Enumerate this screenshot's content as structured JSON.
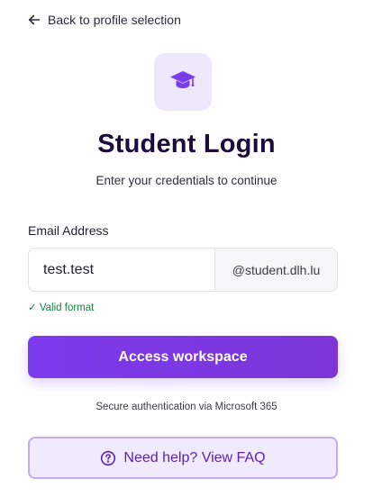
{
  "nav": {
    "back_label": "Back to profile selection",
    "back_icon": "arrow-left-icon"
  },
  "header": {
    "logo_icon": "graduation-cap-icon",
    "title": "Student Login",
    "subtitle": "Enter your credentials to continue"
  },
  "form": {
    "email_label": "Email Address",
    "email_value": "test.test",
    "email_suffix": "@student.dlh.lu",
    "validation_message": "✓ Valid format"
  },
  "actions": {
    "submit_label": "Access workspace",
    "secure_note": "Secure authentication via Microsoft 365",
    "help_label": "Need help? View FAQ",
    "help_icon": "question-circle-icon"
  },
  "colors": {
    "accent": "#7c3aed",
    "title": "#1c0b3b",
    "valid": "#15803d",
    "logo_tile_bg": "#eee8fc",
    "help_bg": "#f1eafd",
    "help_border": "#c4a9f3"
  }
}
